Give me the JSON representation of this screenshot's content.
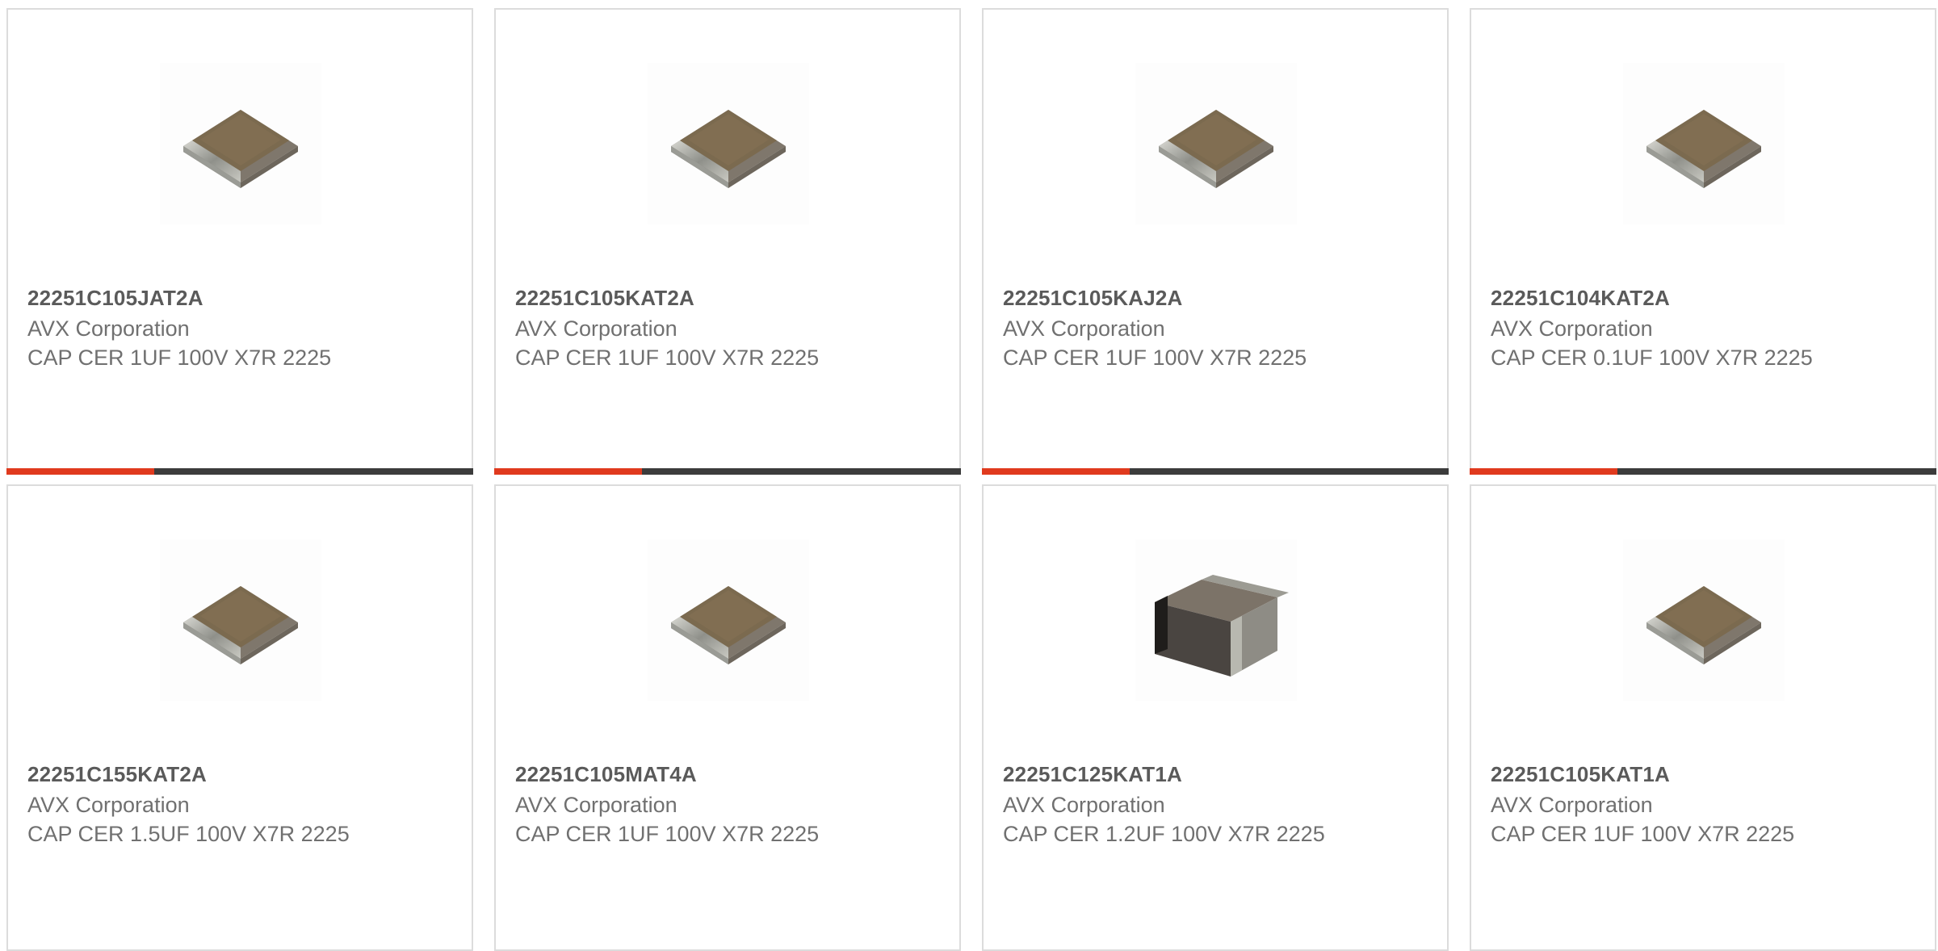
{
  "colors": {
    "accent": "#e03a1e",
    "bar_dark": "#3c3c3c",
    "card_border": "#dcdcdc",
    "part_text": "#5a5a5a",
    "body_text": "#707070"
  },
  "products": [
    {
      "part_number": "22251C105JAT2A",
      "manufacturer": "AVX Corporation",
      "description": "CAP CER 1UF 100V X7R 2225",
      "image_icon": "mlcc-flat-chip-icon",
      "highlight_bar": true
    },
    {
      "part_number": "22251C105KAT2A",
      "manufacturer": "AVX Corporation",
      "description": "CAP CER 1UF 100V X7R 2225",
      "image_icon": "mlcc-flat-chip-icon",
      "highlight_bar": true
    },
    {
      "part_number": "22251C105KAJ2A",
      "manufacturer": "AVX Corporation",
      "description": "CAP CER 1UF 100V X7R 2225",
      "image_icon": "mlcc-flat-chip-icon",
      "highlight_bar": true
    },
    {
      "part_number": "22251C104KAT2A",
      "manufacturer": "AVX Corporation",
      "description": "CAP CER 0.1UF 100V X7R 2225",
      "image_icon": "mlcc-flat-chip-icon",
      "highlight_bar": true
    },
    {
      "part_number": "22251C155KAT2A",
      "manufacturer": "AVX Corporation",
      "description": "CAP CER 1.5UF 100V X7R 2225",
      "image_icon": "mlcc-flat-chip-icon",
      "highlight_bar": false
    },
    {
      "part_number": "22251C105MAT4A",
      "manufacturer": "AVX Corporation",
      "description": "CAP CER 1UF 100V X7R 2225",
      "image_icon": "mlcc-flat-chip-icon",
      "highlight_bar": false
    },
    {
      "part_number": "22251C125KAT1A",
      "manufacturer": "AVX Corporation",
      "description": "CAP CER 1.2UF 100V X7R 2225",
      "image_icon": "mlcc-thick-chip-icon",
      "highlight_bar": false
    },
    {
      "part_number": "22251C105KAT1A",
      "manufacturer": "AVX Corporation",
      "description": "CAP CER 1UF 100V X7R 2225",
      "image_icon": "mlcc-flat-chip-icon",
      "highlight_bar": false
    }
  ]
}
